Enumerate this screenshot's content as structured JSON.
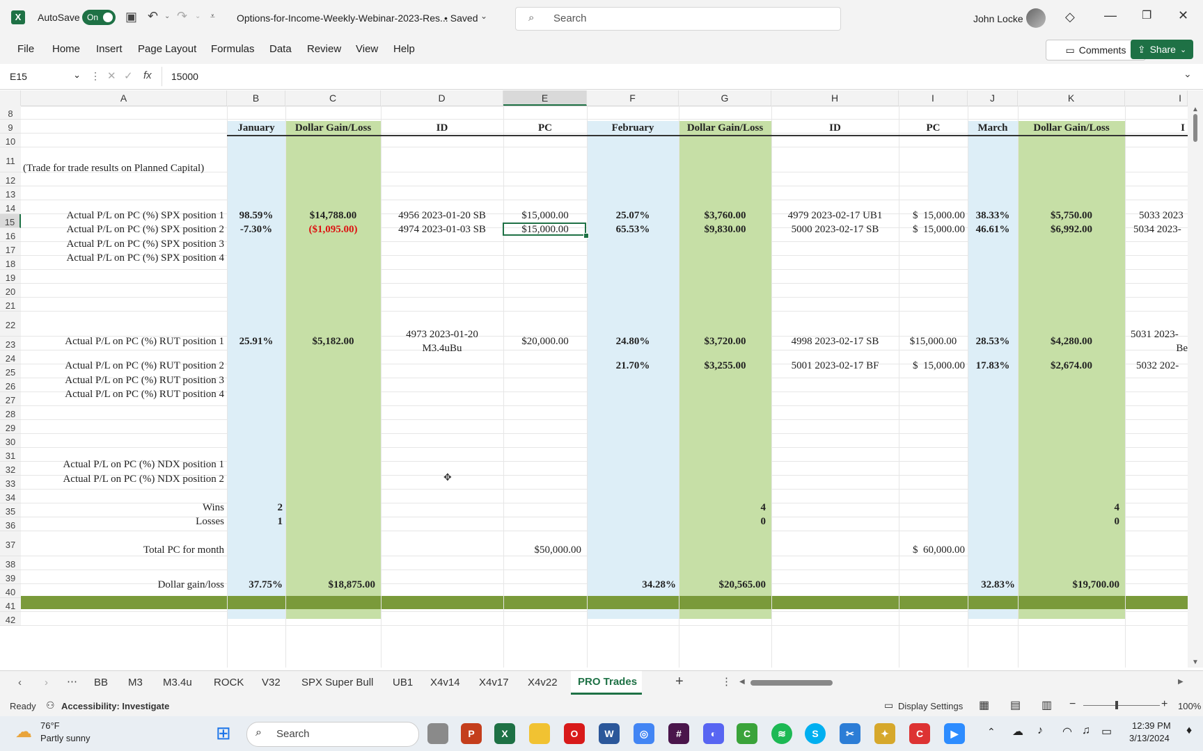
{
  "titlebar": {
    "autosave_label": "AutoSave",
    "autosave_state": "On",
    "filename": "Options-for-Income-Weekly-Webinar-2023-Res...",
    "saved_status": "• Saved",
    "search_placeholder": "Search",
    "user_name": "John Locke"
  },
  "ribbon": {
    "tabs": [
      "File",
      "Home",
      "Insert",
      "Page Layout",
      "Formulas",
      "Data",
      "Review",
      "View",
      "Help"
    ],
    "comments_label": "Comments",
    "share_label": "Share"
  },
  "formulabar": {
    "name_box": "E15",
    "fx": "fx",
    "value": "15000"
  },
  "columns": [
    "A",
    "B",
    "C",
    "D",
    "E",
    "F",
    "G",
    "H",
    "I",
    "J",
    "K",
    "I"
  ],
  "rows": [
    "8",
    "9",
    "10",
    "11",
    "12",
    "13",
    "14",
    "15",
    "16",
    "17",
    "18",
    "19",
    "20",
    "21",
    "22",
    "23",
    "24",
    "25",
    "26",
    "27",
    "28",
    "29",
    "30",
    "31",
    "32",
    "33",
    "34",
    "35",
    "36",
    "37",
    "38",
    "39",
    "40",
    "41",
    "42"
  ],
  "cells": {
    "b9": "January",
    "c9": "Dollar Gain/Loss",
    "d9": "ID",
    "e9": "PC",
    "f9": "February",
    "g9": "Dollar Gain/Loss",
    "h9": "ID",
    "i9": "PC",
    "j9": "March",
    "k9": "Dollar Gain/Loss",
    "l9": "I",
    "a11": "(Trade for trade results on Planned Capital)",
    "a14": "Actual P/L on PC (%) SPX position 1",
    "b14": "98.59%",
    "c14": "$14,788.00",
    "d14": "4956 2023-01-20 SB",
    "e14": "$15,000.00",
    "f14": "25.07%",
    "g14": "$3,760.00",
    "h14": "4979 2023-02-17 UB1",
    "i14": "$  15,000.00",
    "j14": "38.33%",
    "k14": "$5,750.00",
    "l14": "5033 2023",
    "a15": "Actual P/L on PC (%) SPX position 2",
    "b15": "-7.30%",
    "c15": "($1,095.00)",
    "d15": "4974 2023-01-03 SB",
    "e15": "$15,000.00",
    "f15": "65.53%",
    "g15": "$9,830.00",
    "h15": "5000 2023-02-17 SB",
    "i15": "$  15,000.00",
    "j15": "46.61%",
    "k15": "$6,992.00",
    "l15": "5034 2023-",
    "a16": "Actual P/L on PC (%) SPX position 3",
    "a17": "Actual P/L on PC (%) SPX position 4",
    "a22": "Actual P/L on PC (%) RUT position 1",
    "b22": "25.91%",
    "c22": "$5,182.00",
    "d22a": "4973 2023-01-20",
    "d22b": "M3.4uBu",
    "e22": "$20,000.00",
    "f22": "24.80%",
    "g22": "$3,720.00",
    "h22": "4998 2023-02-17 SB",
    "i22": "$15,000.00",
    "j22": "28.53%",
    "k22": "$4,280.00",
    "l22a": "5031 2023-",
    "l22b": "Be",
    "a23": "Actual P/L on PC (%) RUT position 2",
    "f23": "21.70%",
    "g23": "$3,255.00",
    "h23": "5001 2023-02-17 BF",
    "i23": "$  15,000.00",
    "j23": "17.83%",
    "k23": "$2,674.00",
    "l23": "5032 202-",
    "a24": "Actual P/L on PC (%) RUT position 3",
    "a25": "Actual P/L on PC (%) RUT position 4",
    "a30": "Actual P/L on PC (%) NDX position 1",
    "a31": "Actual P/L on PC (%) NDX position 2",
    "a33": "Wins",
    "b33": "2",
    "g33": "4",
    "k33": "4",
    "a34": "Losses",
    "b34": "1",
    "g34": "0",
    "k34": "0",
    "a36": "Total PC for month",
    "e36": "$50,000.00",
    "i36": "$  60,000.00",
    "a37": "Dollar gain/loss",
    "b37": "37.75%",
    "c37": "$18,875.00",
    "f37": "34.28%",
    "g37": "$20,565.00",
    "j37": "32.83%",
    "k37": "$19,700.00"
  },
  "sheets": [
    "BB",
    "M3",
    "M3.4u",
    "ROCK",
    "V32",
    "SPX Super Bull",
    "UB1",
    "X4v14",
    "X4v17",
    "X4v22",
    "PRO Trades"
  ],
  "active_sheet": "PRO Trades",
  "statusbar": {
    "ready": "Ready",
    "accessibility": "Accessibility: Investigate",
    "display_settings": "Display Settings",
    "zoom": "100%"
  },
  "taskbar": {
    "weather_temp": "76°F",
    "weather_desc": "Partly sunny",
    "search_placeholder": "Search",
    "time": "12:39 PM",
    "date": "3/13/2024"
  },
  "colors": {
    "excel_green": "#1e7145",
    "blue_fill": "#ddeef7",
    "green_fill": "#c6dfa6",
    "band": "#7a9a3a",
    "loss_red": "#d11111"
  }
}
